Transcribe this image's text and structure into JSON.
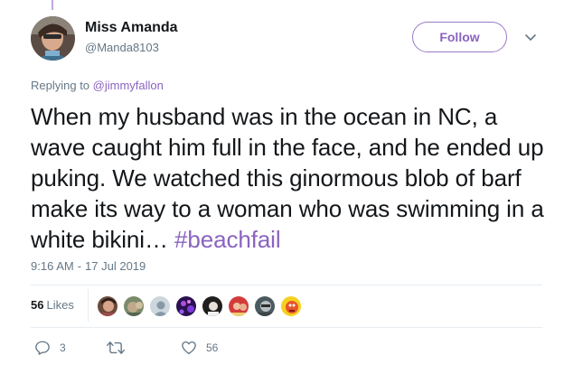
{
  "tweet": {
    "display_name": "Miss Amanda",
    "username": "@Manda8103",
    "follow_label": "Follow",
    "replying_prefix": "Replying to",
    "replying_handle": "@jimmyfallon",
    "text": "When my husband was in the ocean in NC, a wave caught him full in the face, and he ended up puking. We watched this ginormous blob of barf make its way to a woman who was swimming in a white bikini…",
    "hashtag": "#beachfail",
    "time": "9:16 AM",
    "date_separator": "-",
    "date": "17 Jul 2019"
  },
  "engagement": {
    "likes_count": "56",
    "likes_label": "Likes",
    "likers": [
      "liker-1",
      "liker-2",
      "liker-3",
      "liker-4",
      "liker-5",
      "liker-6",
      "liker-7",
      "liker-8"
    ]
  },
  "actions": {
    "reply_count": "3",
    "retweet_count": "",
    "like_count": "56"
  },
  "colors": {
    "accent": "#8a63c0",
    "text": "#14171a",
    "secondary": "#657786",
    "divider": "#e6ecf0"
  },
  "icons": {
    "caret": "chevron-down-icon",
    "reply": "reply-icon",
    "retweet": "retweet-icon",
    "like": "heart-icon"
  }
}
